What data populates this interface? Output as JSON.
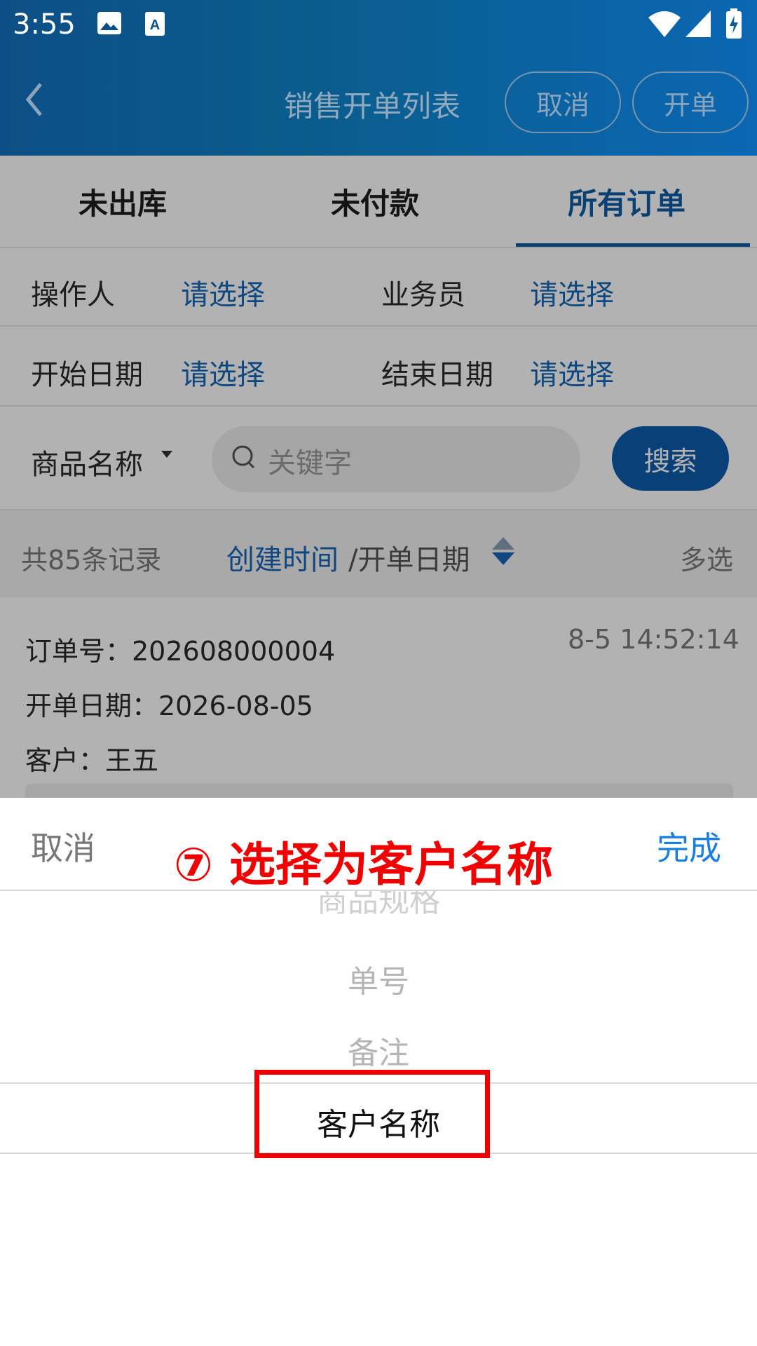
{
  "status_bar": {
    "time": "3:55"
  },
  "header": {
    "title": "销售开单列表",
    "cancel_label": "取消",
    "create_label": "开单"
  },
  "tabs": [
    {
      "label": "未出库",
      "active": false
    },
    {
      "label": "未付款",
      "active": false
    },
    {
      "label": "所有订单",
      "active": true
    }
  ],
  "filters": {
    "operator_label": "操作人",
    "operator_value": "请选择",
    "salesman_label": "业务员",
    "salesman_value": "请选择",
    "start_label": "开始日期",
    "start_value": "请选择",
    "end_label": "结束日期",
    "end_value": "请选择"
  },
  "search": {
    "field": "商品名称",
    "placeholder": "关键字",
    "button": "搜索"
  },
  "list_meta": {
    "count": "共85条记录",
    "sort_primary": "创建时间",
    "sort_secondary": "/开单日期",
    "multi": "多选"
  },
  "order": {
    "number": "订单号：202608000004",
    "time": "8-5 14:52:14",
    "date": "开单日期：2026-08-05",
    "customer": "客户：王五"
  },
  "picker": {
    "cancel": "取消",
    "done": "完成",
    "annotation": "⑦ 选择为客户名称",
    "options": [
      "商品规格",
      "单号",
      "备注",
      "客户名称"
    ],
    "selected_index": 3
  },
  "colors": {
    "accent": "#0f5ea8",
    "annotation": "#f00000",
    "done": "#1b7fe0"
  }
}
